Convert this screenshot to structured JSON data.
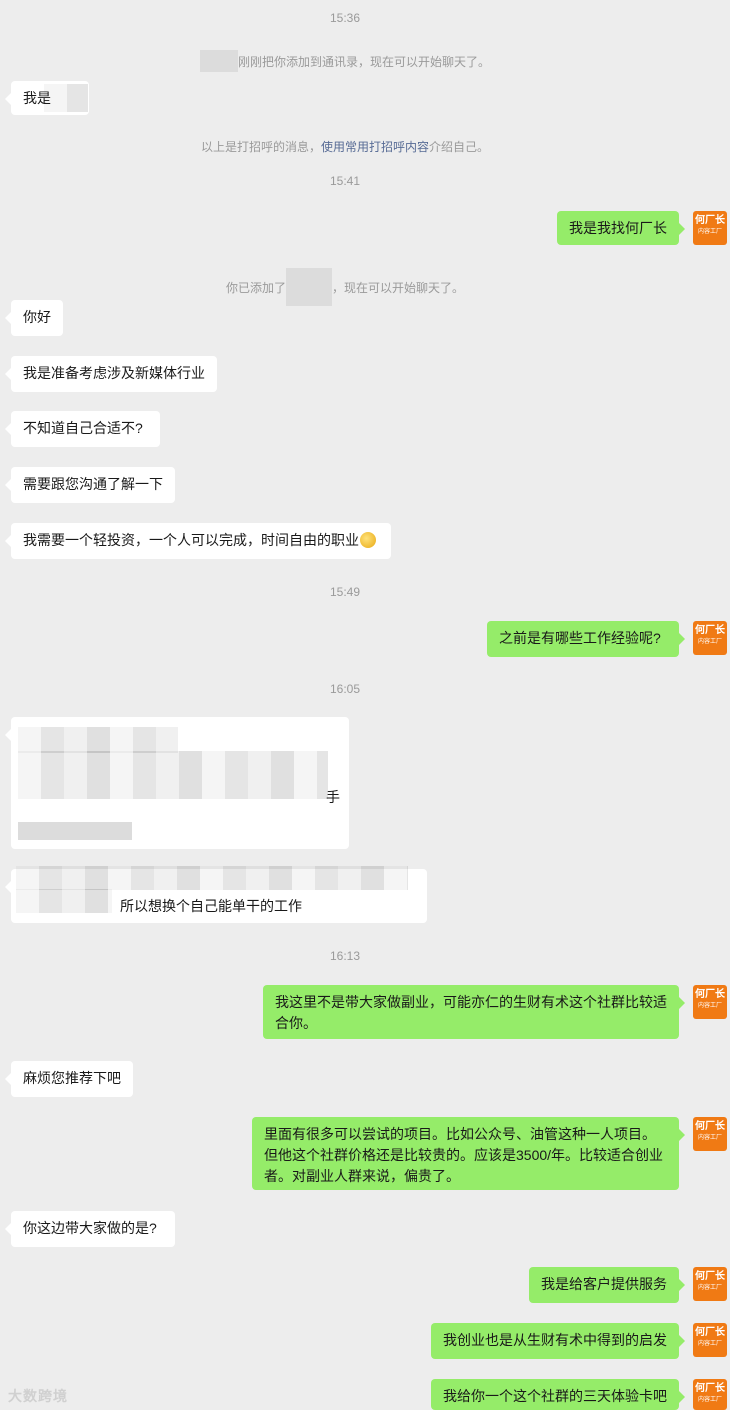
{
  "timestamps": {
    "t1": "15:36",
    "t2": "15:41",
    "t3": "15:49",
    "t4": "16:05",
    "t5": "16:13"
  },
  "system": {
    "added_tail": "刚刚把你添加到通讯录，现在可以开始聊天了。",
    "greeting_prefix": "以上是打招呼的消息，",
    "greeting_link": "使用常用打招呼内容",
    "greeting_suffix": "介绍自己。",
    "you_added_prefix": "你已添加了",
    "you_added_suffix": "，现在可以开始聊天了。"
  },
  "avatar": {
    "line1": "何厂长",
    "line2": "内容工厂",
    "color": "#f07a14"
  },
  "messages": {
    "m1": "我是",
    "m2": "我是我找何厂长",
    "m3": "你好",
    "m4": "我是准备考虑涉及新媒体行业",
    "m5": "不知道自己合适不?",
    "m6": "需要跟您沟通了解一下",
    "m7": "我需要一个轻投资，一个人可以完成，时间自由的职业",
    "m8": "之前是有哪些工作经验呢?",
    "m9_tail": "手",
    "m10": "所以想换个自己能单干的工作",
    "m11": "我这里不是带大家做副业，可能亦仁的生财有术这个社群比较适合你。",
    "m12": "麻烦您推荐下吧",
    "m13": "里面有很多可以尝试的项目。比如公众号、油管这种一人项目。但他这个社群价格还是比较贵的。应该是3500/年。比较适合创业者。对副业人群来说，偏贵了。",
    "m14": "你这边带大家做的是?",
    "m15": "我是给客户提供服务",
    "m16": "我创业也是从生财有术中得到的启发",
    "m17": "我给你一个这个社群的三天体验卡吧"
  },
  "watermark": "大数跨境",
  "colors": {
    "background": "#ededed",
    "incoming_bubble": "#ffffff",
    "outgoing_bubble": "#95ec69",
    "link": "#576b95"
  }
}
